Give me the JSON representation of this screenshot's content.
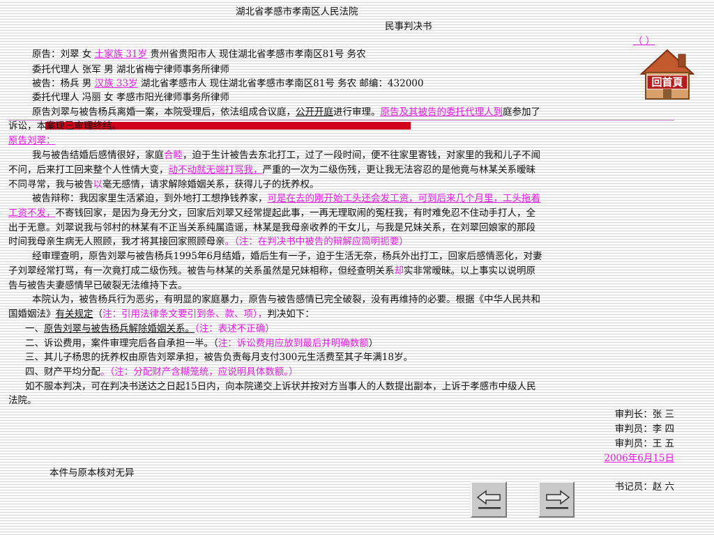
{
  "header": {
    "court": "湖北省孝感市孝南区人民法院",
    "doc_type": "民事判决书",
    "case_no": "（    ）"
  },
  "parties": {
    "plaintiff_a": "原告：刘翠  女 ",
    "plaintiff_b": "土家族 31岁",
    "plaintiff_c": " 贵州省贵阳市人  现住湖北省孝感市孝南区81号  务农",
    "plaintiff_agent": "委托代理人  张军  男  湖北省梅宁律师事务所律师",
    "defendant_a": "被告：杨兵  男  ",
    "defendant_b": "汉族 33岁",
    "defendant_c": "  湖北省孝感市人  现住湖北省孝感市孝南区81号  务农  邮编：432000",
    "defendant_agent": "委托代理人  冯丽  女  孝感市阳光律师事务所律师"
  },
  "intro": {
    "p1_a": "原告刘翠与被告杨兵离婚一案，本院受理后，依法组成合议庭，",
    "p1_b": "公开开庭",
    "p1_c": "进行审理。",
    "p1_d": "原告及其被告的委托代理人到",
    "p1_e": "庭参加了",
    "p2_a": "诉讼，",
    "p2_b": "本案现已审理终结。"
  },
  "plaintiff_claim": {
    "heading": "原告刘翠：",
    "l1_a": "我与被告结婚后感情很好，家庭",
    "l1_b": "合睦",
    "l1_c": "，迫于生计被告去东北打工，过了一段时间，便不往家里寄钱，对家里的我和儿子不闻",
    "l2_a": "不问，后来打工回来整个人性情大变，",
    "l2_b": "动不动就无端打骂我，",
    "l2_c": "严重的一次为二级伤残，更让我无法容忍的是他竟与林某关系暧昧",
    "l3_a": "不同寻常，我与被告",
    "l3_b": "以",
    "l3_c": "毫无感情，请求解除婚姻关系，获得儿子的抚养权。"
  },
  "defendant_defense": {
    "l1_a": "被告辩称：我因家里生活紧迫，到外地打工想挣钱养家，",
    "l1_b": "可是在去的刚开始工头还会发工资，可到后来几个月里，工头拖着",
    "l2_a": "工资不发，",
    "l2_b": "不寄钱回家，是因为身无分文，回家后刘翠又经常提起此事，一再无理取闹的冤枉我，有时难免忍不住动手打人，全",
    "l3": "出于无意。刘翠说我与邻村的林某有不正当关系纯属造谣，林某是我母亲收养的干女儿，与我是兄妹关系，在刘翠回娘家的那段",
    "l4_a": "时间我母亲生病无人照顾，我才将其接回家照顾母亲",
    "l4_b": "。（注：在判决书中被告的辩解应简明扼要）"
  },
  "findings": {
    "l1": "经审理查明，原告刘翠与被告杨兵1995年6月结婚，婚后生有一子，迫于生活无奈，杨兵外出打工，回家后感情恶化，对妻",
    "l2_a": "子刘翠经常打骂，有一次竟打成二级伤残。被告与林某的关系虽然是兄妹相称，但经查明关系",
    "l2_b": "却",
    "l2_c": "实非常暧昧。以上事实以说明原",
    "l3": "告与被告夫妻感情早已破裂无法维持下去。"
  },
  "reasoning": {
    "l1": "本院认为，被告杨兵行为恶劣，有明显的家庭暴力，原告与被告感情已完全破裂，没有再维持的必要。根据《中华人民共和",
    "l2_a": "国婚姻法》",
    "l2_b": "有关规定",
    "l2_c": "（",
    "l2_d": "注：引用法律条文要引到条、款、项），",
    "l2_e": "判决如下："
  },
  "judgment": {
    "i1_a": "一、",
    "i1_b": "原告刘翠与被告杨兵解除婚姻关系。",
    "i1_c": "（注：表述不正确）",
    "i2_a": "二、诉讼费用，案件审理完后各自承担一半。（",
    "i2_b": "注：诉讼费用应放到最后并明确数额",
    "i2_c": "）",
    "i3": "三、其儿子杨思的抚养权由原告刘翠承担，被告负责每月支付300元生活费至其子年满18岁。",
    "i4_a": "四、财产平均分配",
    "i4_b": "。（注：分配财产含糊笼统，应说明具体数额。）"
  },
  "appeal": {
    "l1": "如不服本判决，可在判决书送达之日起15日内，向本院递交上诉状并按对方当事人的人数提出副本，上诉于孝感市中级人民",
    "l2": "法院。"
  },
  "signatures": {
    "chief_judge": "审判长：张  三",
    "judge_1": "审判员：李  四",
    "judge_2": "审判员：王  五",
    "date": "2006年6月15日",
    "certify": "本件与原本核对无异",
    "clerk": "书记员：赵  六"
  },
  "nav": {
    "home_label": "回首頁",
    "colors": {
      "roof": "#c25a2e",
      "wall": "#d8a06a",
      "sign_bg": "#b21c1c",
      "sign_text": "#ffffff",
      "marker_red": "#d0021b",
      "annotation": "#e020e0"
    }
  }
}
